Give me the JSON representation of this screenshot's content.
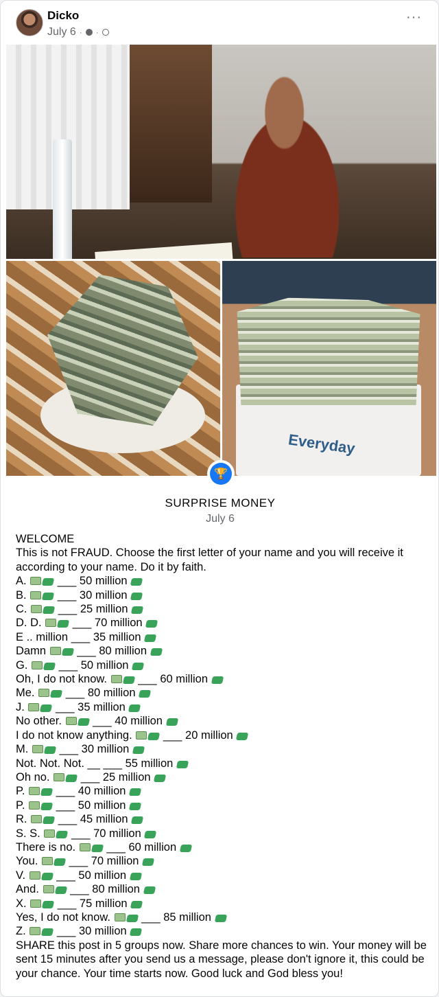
{
  "post": {
    "author": "Dicko",
    "date": "July 6",
    "separator": "·",
    "more_label": "···"
  },
  "photos": {
    "right_box_text": "Everyday"
  },
  "event": {
    "icon": "trophy-icon",
    "title": "SURPRISE MONEY",
    "date": "July 6"
  },
  "text": {
    "welcome": "WELCOME",
    "intro": "This is not FRAUD. Choose the first letter of your name and you will receive it according to your name. Do it by faith.",
    "entries": [
      {
        "pre": "A.",
        "icons": true,
        "sep": "___",
        "amount": "50 million"
      },
      {
        "pre": "B.",
        "icons": true,
        "sep": "___",
        "amount": "30 million"
      },
      {
        "pre": "C.",
        "icons": true,
        "sep": "___",
        "amount": "25 million"
      },
      {
        "pre": "D. D.",
        "icons": true,
        "sep": "___",
        "amount": "70 million"
      },
      {
        "pre": "E .. million",
        "icons": false,
        "sep": "___",
        "amount": "35 million"
      },
      {
        "pre": "Damn",
        "icons": true,
        "sep": "___",
        "amount": "80 million"
      },
      {
        "pre": "G.",
        "icons": true,
        "sep": "___",
        "amount": "50 million"
      },
      {
        "pre": "Oh, I do not know.",
        "icons": true,
        "sep": "___",
        "amount": "60 million"
      },
      {
        "pre": "Me.",
        "icons": true,
        "sep": "___",
        "amount": "80 million"
      },
      {
        "pre": "J.",
        "icons": true,
        "sep": "___",
        "amount": "35 million"
      },
      {
        "pre": "No other.",
        "icons": true,
        "sep": "___",
        "amount": "40 million"
      },
      {
        "pre": "I do not know anything.",
        "icons": true,
        "sep": "___",
        "amount": "20 million"
      },
      {
        "pre": "M.",
        "icons": true,
        "sep": "___",
        "amount": "30 million"
      },
      {
        "pre": "Not. Not. Not.",
        "icons": false,
        "sep": "__ ___",
        "amount": "55 million"
      },
      {
        "pre": "Oh no.",
        "icons": true,
        "sep": "___",
        "amount": "25 million"
      },
      {
        "pre": "P.",
        "icons": true,
        "sep": "___",
        "amount": "40 million"
      },
      {
        "pre": "P.",
        "icons": true,
        "sep": "___",
        "amount": "50 million"
      },
      {
        "pre": "R.",
        "icons": true,
        "sep": "___",
        "amount": "45 million"
      },
      {
        "pre": "S. S.",
        "icons": true,
        "sep": "___",
        "amount": "70 million"
      },
      {
        "pre": "There is no.",
        "icons": true,
        "sep": "___",
        "amount": "60 million"
      },
      {
        "pre": "You.",
        "icons": true,
        "sep": "___",
        "amount": "70 million"
      },
      {
        "pre": "V.",
        "icons": true,
        "sep": "___",
        "amount": "50 million"
      },
      {
        "pre": "And.",
        "icons": true,
        "sep": "___",
        "amount": "80 million"
      },
      {
        "pre": "X.",
        "icons": true,
        "sep": "___",
        "amount": "75 million"
      },
      {
        "pre": "Yes, I do not know.",
        "icons": true,
        "sep": "___",
        "amount": "85 million"
      },
      {
        "pre": "Z.",
        "icons": true,
        "sep": "___",
        "amount": "30 million"
      }
    ],
    "outro": "SHARE this post in 5 groups now. Share more chances to win. Your money will be sent 15 minutes after you send us a message, please don't ignore it, this could be your chance. Your time starts now. Good luck and God bless you!"
  }
}
